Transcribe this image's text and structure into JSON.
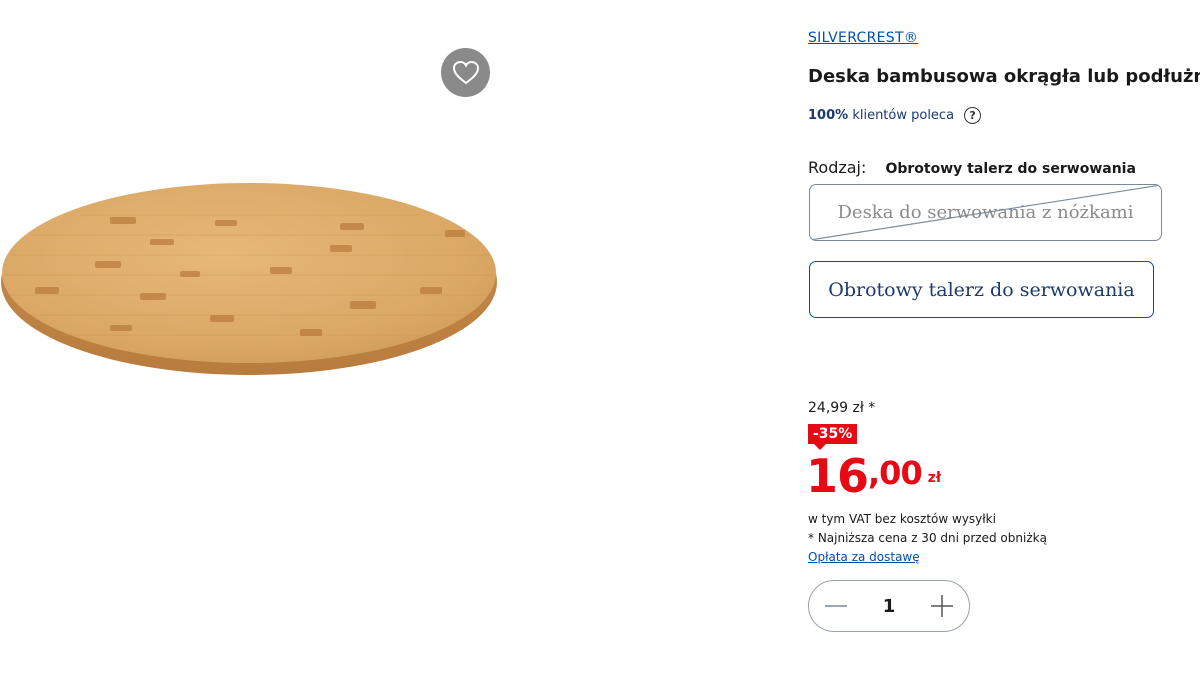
{
  "product": {
    "brand": "SILVERCREST®",
    "title": "Deska bambusowa okrągła lub podłużna",
    "recommend_percent": "100%",
    "recommend_text": "klientów poleca",
    "variant_label": "Rodzaj:",
    "variant_value": "Obrotowy talerz do serwowania",
    "options": [
      {
        "label": "Deska do serwowania z nóżkami",
        "available": false
      },
      {
        "label": "Obrotowy talerz do serwowania",
        "available": true,
        "selected": true
      }
    ]
  },
  "pricing": {
    "old_price": "24,99 zł *",
    "discount": "-35%",
    "price_int": "16",
    "price_dec": ",00",
    "currency": "zł",
    "vat_note": "w tym VAT bez kosztów wysyłki",
    "lowest_note": "* Najniższa cena z 30 dni przed obniżką",
    "shipping_link": "Opłata za dostawę"
  },
  "quantity": {
    "value": "1"
  },
  "icons": {
    "wishlist": "heart-icon",
    "help": "question-circle-icon",
    "decrease": "minus-icon",
    "increase": "plus-icon"
  },
  "colors": {
    "accent_blue": "#0050aa",
    "price_red": "#e60a14",
    "wishlist_bg": "#8a8a8a"
  }
}
